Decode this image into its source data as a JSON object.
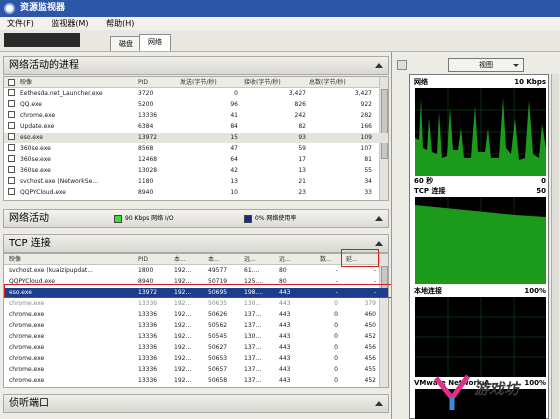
{
  "window": {
    "title": "资源监视器"
  },
  "menu": {
    "file": "文件(F)",
    "monitor": "监视器(M)",
    "help": "帮助(H)"
  },
  "tabs": [
    {
      "label": "磁盘"
    },
    {
      "label": "网络"
    }
  ],
  "processes": {
    "title": "网络活动的进程",
    "headers": [
      "映像",
      "PID",
      "发送(字节/秒)",
      "接收(字节/秒)",
      "总数(字节/秒)"
    ],
    "rows": [
      [
        "Eethesda.net_Launcher.exe",
        "3720",
        "0",
        "3,427",
        "3,427"
      ],
      [
        "QQ.exe",
        "5200",
        "96",
        "826",
        "922"
      ],
      [
        "chrome.exe",
        "13336",
        "41",
        "242",
        "282"
      ],
      [
        "Update.exe",
        "6384",
        "84",
        "82",
        "166"
      ],
      [
        "eso.exe",
        "13972",
        "15",
        "93",
        "109"
      ],
      [
        "360se.exe",
        "8568",
        "47",
        "59",
        "107"
      ],
      [
        "360se.exe",
        "12468",
        "64",
        "17",
        "81"
      ],
      [
        "360se.exe",
        "13028",
        "42",
        "13",
        "55"
      ],
      [
        "svchost.exe (NetworkSe...",
        "1180",
        "13",
        "21",
        "34"
      ],
      [
        "QQPYCloud.exe",
        "8940",
        "10",
        "23",
        "33"
      ]
    ]
  },
  "network_activity": {
    "title": "网络活动",
    "io_label": "90 Kbps 网络 I/O",
    "usage_label": "0% 网络使用率"
  },
  "tcp": {
    "title": "TCP 连接",
    "headers": [
      "映像",
      "PID",
      "本...",
      "本...",
      "远...",
      "远...",
      "数...",
      "延..."
    ],
    "rows": [
      [
        "svchost.exe (kuaizipupdat...",
        "1800",
        "192...",
        "49577",
        "61....",
        "80",
        "-",
        "-"
      ],
      [
        "QQPYCloud.exe",
        "8940",
        "192...",
        "50719",
        "125....",
        "80",
        "-",
        "-"
      ],
      [
        "eso.exe",
        "13972",
        "192...",
        "50695",
        "198....",
        "443",
        "-",
        "-"
      ],
      [
        "chrome.exe",
        "13336",
        "192...",
        "50635",
        "130...",
        "443",
        "0",
        "379"
      ],
      [
        "chrome.exe",
        "13336",
        "192...",
        "50626",
        "137...",
        "443",
        "0",
        "460"
      ],
      [
        "chrome.exe",
        "13336",
        "192...",
        "50562",
        "137...",
        "443",
        "0",
        "450"
      ],
      [
        "chrome.exe",
        "13336",
        "192...",
        "50545",
        "130...",
        "443",
        "0",
        "452"
      ],
      [
        "chrome.exe",
        "13336",
        "192...",
        "50627",
        "137...",
        "443",
        "0",
        "456"
      ],
      [
        "chrome.exe",
        "13336",
        "192...",
        "50653",
        "137...",
        "443",
        "0",
        "456"
      ],
      [
        "chrome.exe",
        "13336",
        "192...",
        "50657",
        "137...",
        "443",
        "0",
        "455"
      ],
      [
        "chrome.exe",
        "13336",
        "192...",
        "50658",
        "137...",
        "443",
        "0",
        "452"
      ]
    ]
  },
  "listen": {
    "title": "侦听端口"
  },
  "right": {
    "view_label": "视图",
    "graphs": [
      {
        "name": "网络",
        "scale": "10 Kbps"
      },
      {
        "name": "60 秒",
        "scale": "0"
      },
      {
        "name": "TCP 连接",
        "scale": "50"
      },
      {
        "name": "本地连接",
        "scale": "100%"
      },
      {
        "name": "VMware Network A...",
        "scale": "100%"
      }
    ]
  },
  "watermark": {
    "text": "游戏坊"
  },
  "colors": {
    "io_swatch": "#3ddc3d",
    "usage_swatch": "#1e2a8a",
    "graph_line": "#35e035",
    "highlight": "#d02020"
  }
}
